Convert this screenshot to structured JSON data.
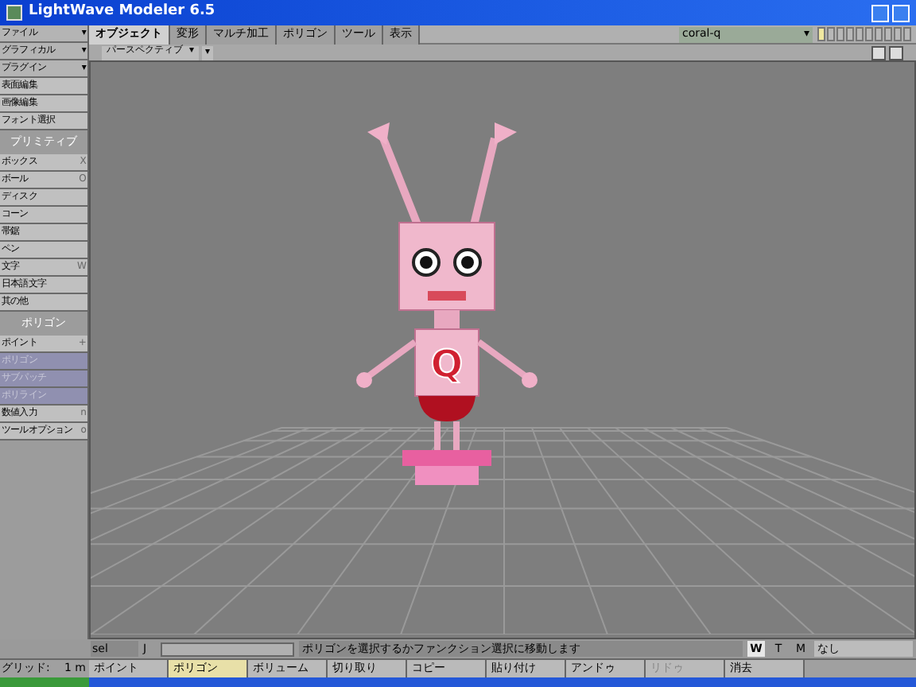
{
  "window": {
    "title": "LightWave Modeler 6.5"
  },
  "sidebar": {
    "items": [
      {
        "kind": "menu",
        "label": "ファイル",
        "arrow": "▾"
      },
      {
        "kind": "menu",
        "label": "グラフィカル",
        "arrow": "▾"
      },
      {
        "kind": "menu",
        "label": "プラグイン",
        "arrow": "▾"
      },
      {
        "kind": "item",
        "label": "表面編集",
        "disabled": false
      },
      {
        "kind": "item",
        "label": "画像編集",
        "disabled": false
      },
      {
        "kind": "item",
        "label": "フォント選択",
        "disabled": false
      },
      {
        "kind": "header",
        "label": "プリミティブ"
      },
      {
        "kind": "item",
        "label": "ボックス",
        "key": "X",
        "disabled": false
      },
      {
        "kind": "item",
        "label": "ボール",
        "key": "O",
        "disabled": false
      },
      {
        "kind": "item",
        "label": "ディスク",
        "disabled": false
      },
      {
        "kind": "item",
        "label": "コーン",
        "disabled": false
      },
      {
        "kind": "item",
        "label": "帯鋸",
        "disabled": false
      },
      {
        "kind": "item",
        "label": "ペン",
        "disabled": false
      },
      {
        "kind": "item",
        "label": "文字",
        "key": "W",
        "disabled": false
      },
      {
        "kind": "item",
        "label": "日本語文字",
        "disabled": false
      },
      {
        "kind": "item",
        "label": "其の他",
        "disabled": false
      },
      {
        "kind": "header",
        "label": "ポリゴン"
      },
      {
        "kind": "item",
        "label": "ポイント",
        "key": "+",
        "disabled": false
      },
      {
        "kind": "item",
        "label": "ポリゴン",
        "disabled": true
      },
      {
        "kind": "item",
        "label": "サブパッチ",
        "disabled": true
      },
      {
        "kind": "item",
        "label": "ポリライン",
        "disabled": true
      },
      {
        "kind": "item",
        "label": "数値入力",
        "key": "n",
        "disabled": false
      },
      {
        "kind": "item",
        "label": "ツールオプション",
        "key": "o",
        "disabled": false
      }
    ]
  },
  "tabs": [
    {
      "label": "オブジェクト",
      "selected": true
    },
    {
      "label": "変形",
      "selected": false
    },
    {
      "label": "マルチ加工",
      "selected": false
    },
    {
      "label": "ポリゴン",
      "selected": false
    },
    {
      "label": "ツール",
      "selected": false
    },
    {
      "label": "表示",
      "selected": false
    }
  ],
  "object_dropdown": {
    "value": "coral-q",
    "arrow": "▾"
  },
  "viewport": {
    "chest_letter": "Q",
    "view": "パースペクティブ",
    "arrow": "▾",
    "menu_arrow": "▾"
  },
  "command": {
    "label": "sel",
    "key": "J",
    "message": "ポリゴンを選択するかファンクション選択に移動します"
  },
  "mode_buttons": [
    {
      "label": "W",
      "selected": true
    },
    {
      "label": "T",
      "selected": false
    },
    {
      "label": "M",
      "selected": false
    }
  ],
  "surface": "なし",
  "status_bar": {
    "grid": "グリッド:",
    "grid_value": "1 m",
    "buttons": [
      {
        "label": "ポイント",
        "selected": false,
        "disabled": false
      },
      {
        "label": "ポリゴン",
        "selected": true,
        "disabled": false
      },
      {
        "label": "ボリューム",
        "selected": false,
        "disabled": false
      },
      {
        "label": "切り取り",
        "selected": false,
        "disabled": false
      },
      {
        "label": "コピー",
        "selected": false,
        "disabled": false
      },
      {
        "label": "貼り付け",
        "selected": false,
        "disabled": false
      },
      {
        "label": "アンドゥ",
        "selected": false,
        "disabled": false
      },
      {
        "label": "リドゥ",
        "selected": false,
        "disabled": true
      },
      {
        "label": "消去",
        "selected": false,
        "disabled": false
      }
    ]
  }
}
